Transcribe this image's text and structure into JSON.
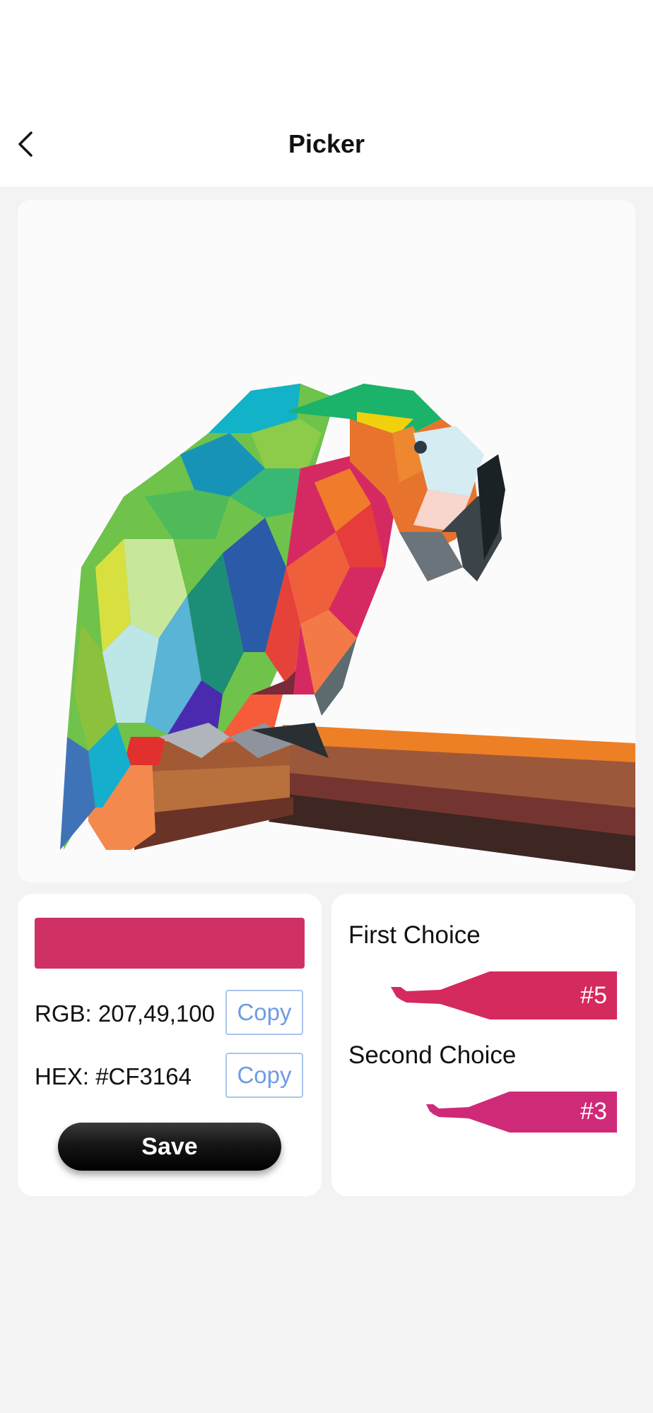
{
  "header": {
    "title": "Picker",
    "back_icon": "chevron-left-icon"
  },
  "picked_color": {
    "swatch_color": "#CF3164",
    "rgb_text": "RGB: 207,49,100",
    "hex_text": "HEX: #CF3164",
    "copy_label": "Copy",
    "save_label": "Save"
  },
  "choices": {
    "first_label": "First Choice",
    "first_number": "#5",
    "first_color": "#D42A5E",
    "second_label": "Second Choice",
    "second_number": "#3",
    "second_color": "#CF2A78"
  },
  "colors": {
    "copy_accent": "#6F9CE3",
    "background": "#F3F3F4"
  }
}
